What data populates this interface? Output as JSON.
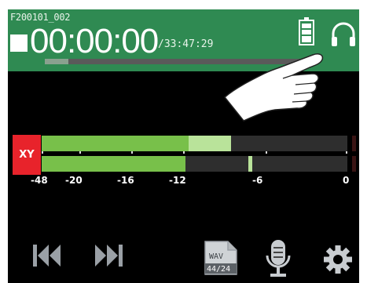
{
  "header": {
    "filename": "F200101_002",
    "elapsed_time": "00:00:00",
    "remaining_time": "/33:47:29",
    "progress_fraction": 0.09
  },
  "meter": {
    "track_label": "XY",
    "channels": [
      {
        "level_fraction": 0.48,
        "peak_fraction": 0.62
      },
      {
        "level_fraction": 0.47,
        "peak_fraction": 0.675
      }
    ],
    "scale": [
      "-48",
      "-20",
      "-16",
      "-12",
      "-6",
      "0"
    ]
  },
  "toolbar": {
    "format_line1": "WAV",
    "format_line2": "44/24"
  },
  "colors": {
    "header_bg": "#2f8a52",
    "meter_green": "#78c04a",
    "track_badge": "#e8232b"
  }
}
